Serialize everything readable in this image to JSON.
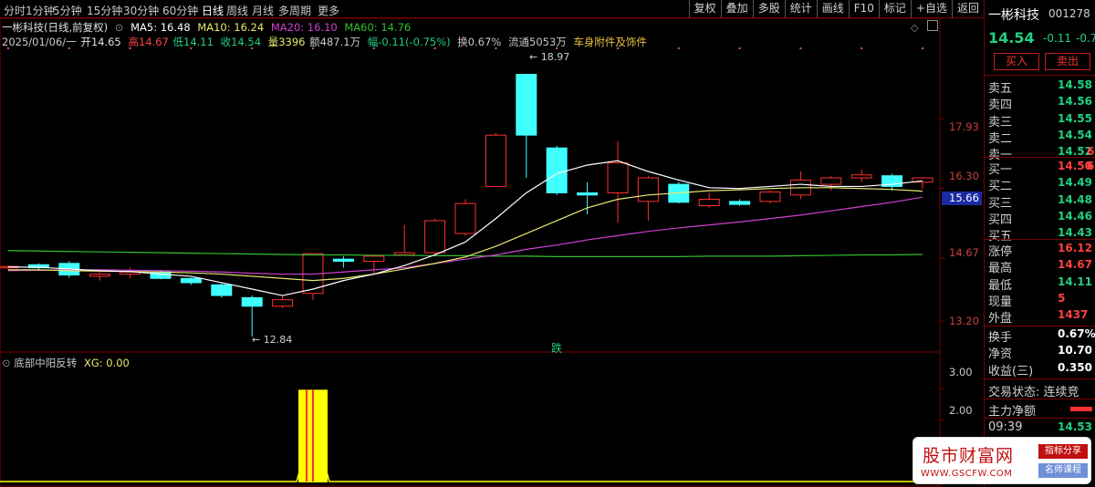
{
  "toolbar": {
    "periods": [
      "分时",
      "1分钟",
      "5分钟",
      "15分钟",
      "30分钟",
      "60分钟",
      "日线",
      "周线",
      "月线",
      "多周期",
      "更多"
    ],
    "active_period": "日线",
    "tools": [
      "复权",
      "叠加",
      "多股",
      "统计",
      "画线",
      "F10",
      "标记",
      "+自选",
      "返回"
    ]
  },
  "header": {
    "title": "一彬科技(日线,前复权)",
    "ma5": "MA5: 16.48",
    "ma10": "MA10: 16.24",
    "ma20": "MA20: 16.10",
    "ma60": "MA60: 14.76",
    "date": "2025/01/06/一",
    "open": "开14.65",
    "high": "高14.67",
    "low": "低14.11",
    "close": "收14.54",
    "volume": "量3396",
    "amount": "额487.1万",
    "change": "幅-0.11(-0.75%)",
    "turnover": "换0.67%",
    "float": "流通5053万",
    "sector": "车身附件及饰件"
  },
  "price_axis": {
    "ticks": [
      "17.93",
      "16.30",
      "14.67",
      "13.20"
    ],
    "current": "15.66"
  },
  "annotations": {
    "high_mark": "18.97",
    "low_mark": "12.84",
    "signal": "跌"
  },
  "indicator": {
    "title": "底部中阳反转",
    "xg": "XG: 0.00",
    "ticks": [
      "3.00",
      "2.00"
    ]
  },
  "colors": {
    "up": "#ff3030",
    "down": "#40ffff",
    "ma5": "#ffffff",
    "ma10": "#e8e870",
    "ma20": "#d040d0",
    "ma60": "#30c030",
    "signal_bar": "#ffff00"
  },
  "chart_data": {
    "type": "candlestick",
    "ylim": [
      12.5,
      19.6
    ],
    "candles": [
      {
        "o": 14.45,
        "c": 14.48,
        "h": 14.5,
        "l": 14.4
      },
      {
        "o": 14.52,
        "c": 14.45,
        "h": 14.55,
        "l": 14.4
      },
      {
        "o": 14.55,
        "c": 14.28,
        "h": 14.6,
        "l": 14.22
      },
      {
        "o": 14.25,
        "c": 14.3,
        "h": 14.35,
        "l": 14.15
      },
      {
        "o": 14.3,
        "c": 14.35,
        "h": 14.45,
        "l": 14.2
      },
      {
        "o": 14.35,
        "c": 14.2,
        "h": 14.4,
        "l": 14.18
      },
      {
        "o": 14.2,
        "c": 14.1,
        "h": 14.22,
        "l": 14.05
      },
      {
        "o": 14.05,
        "c": 13.8,
        "h": 14.08,
        "l": 13.75
      },
      {
        "o": 13.75,
        "c": 13.55,
        "h": 13.8,
        "l": 12.84
      },
      {
        "o": 13.55,
        "c": 13.7,
        "h": 13.8,
        "l": 13.5
      },
      {
        "o": 13.85,
        "c": 14.78,
        "h": 14.78,
        "l": 13.7
      },
      {
        "o": 14.65,
        "c": 14.6,
        "h": 14.72,
        "l": 14.45
      },
      {
        "o": 14.6,
        "c": 14.72,
        "h": 14.75,
        "l": 14.3
      },
      {
        "o": 14.75,
        "c": 14.8,
        "h": 15.45,
        "l": 14.75
      },
      {
        "o": 14.8,
        "c": 15.55,
        "h": 15.6,
        "l": 14.75
      },
      {
        "o": 15.25,
        "c": 15.95,
        "h": 16.05,
        "l": 15.2
      },
      {
        "o": 16.35,
        "c": 17.55,
        "h": 17.6,
        "l": 16.35
      },
      {
        "o": 18.97,
        "c": 17.55,
        "h": 18.97,
        "l": 16.55
      },
      {
        "o": 17.25,
        "c": 16.2,
        "h": 17.3,
        "l": 16.15
      },
      {
        "o": 16.2,
        "c": 16.15,
        "h": 16.45,
        "l": 15.7
      },
      {
        "o": 16.2,
        "c": 16.9,
        "h": 17.4,
        "l": 15.5
      },
      {
        "o": 16.0,
        "c": 16.55,
        "h": 16.6,
        "l": 15.55
      },
      {
        "o": 16.4,
        "c": 15.98,
        "h": 16.45,
        "l": 15.95
      },
      {
        "o": 15.9,
        "c": 16.05,
        "h": 16.2,
        "l": 15.85
      },
      {
        "o": 16.0,
        "c": 15.93,
        "h": 16.05,
        "l": 15.9
      },
      {
        "o": 16.0,
        "c": 16.22,
        "h": 16.25,
        "l": 15.95
      },
      {
        "o": 16.15,
        "c": 16.5,
        "h": 16.7,
        "l": 16.05
      },
      {
        "o": 16.4,
        "c": 16.55,
        "h": 16.6,
        "l": 16.25
      },
      {
        "o": 16.55,
        "c": 16.62,
        "h": 16.75,
        "l": 16.45
      },
      {
        "o": 16.6,
        "c": 16.35,
        "h": 16.65,
        "l": 16.25
      },
      {
        "o": 16.45,
        "c": 16.55,
        "h": 16.57,
        "l": 16.3
      }
    ],
    "ma5": [
      14.47,
      14.46,
      14.42,
      14.38,
      14.36,
      14.3,
      14.25,
      14.1,
      13.95,
      13.8,
      13.95,
      14.15,
      14.3,
      14.5,
      14.75,
      15.05,
      15.6,
      16.2,
      16.65,
      16.85,
      16.95,
      16.7,
      16.5,
      16.32,
      16.3,
      16.35,
      16.4,
      16.35,
      16.35,
      16.4,
      16.48
    ],
    "ma10": [
      14.4,
      14.4,
      14.38,
      14.37,
      14.36,
      14.35,
      14.33,
      14.3,
      14.25,
      14.2,
      14.15,
      14.2,
      14.3,
      14.42,
      14.55,
      14.7,
      14.95,
      15.25,
      15.55,
      15.85,
      16.05,
      16.15,
      16.2,
      16.25,
      16.27,
      16.3,
      16.32,
      16.32,
      16.3,
      16.28,
      16.24
    ],
    "ma20": [
      14.38,
      14.39,
      14.4,
      14.4,
      14.39,
      14.38,
      14.37,
      14.35,
      14.32,
      14.3,
      14.3,
      14.35,
      14.4,
      14.45,
      14.55,
      14.65,
      14.75,
      14.88,
      14.98,
      15.1,
      15.2,
      15.3,
      15.38,
      15.45,
      15.52,
      15.6,
      15.68,
      15.78,
      15.88,
      15.98,
      16.1
    ],
    "ma60": [
      14.85,
      14.84,
      14.83,
      14.82,
      14.81,
      14.8,
      14.79,
      14.78,
      14.77,
      14.76,
      14.75,
      14.75,
      14.74,
      14.74,
      14.73,
      14.73,
      14.72,
      14.72,
      14.71,
      14.71,
      14.71,
      14.71,
      14.71,
      14.72,
      14.72,
      14.72,
      14.73,
      14.74,
      14.75,
      14.75,
      14.76
    ],
    "indicator_values": [
      0,
      0,
      0,
      0,
      0,
      0,
      0,
      0,
      0,
      0,
      3,
      0,
      0,
      0,
      0,
      0,
      0,
      0,
      0,
      0,
      0,
      0,
      0,
      0,
      0,
      0,
      0,
      0,
      0,
      0,
      0
    ],
    "indicator_ylim": [
      0,
      3.6
    ]
  },
  "panel": {
    "name": "一彬科技",
    "code": "001278",
    "price": "14.54",
    "change": "-0.11",
    "change_pct": "-0.7",
    "buy_btn": "买入",
    "sell_btn": "卖出",
    "asks": [
      {
        "label": "卖五",
        "price": "14.58",
        "qty": ""
      },
      {
        "label": "卖四",
        "price": "14.56",
        "qty": ""
      },
      {
        "label": "卖三",
        "price": "14.55",
        "qty": ""
      },
      {
        "label": "卖二",
        "price": "14.54",
        "qty": ""
      },
      {
        "label": "卖一",
        "price": "14.52",
        "qty": "6"
      }
    ],
    "bids": [
      {
        "label": "买一",
        "price": "14.50",
        "qty": "6"
      },
      {
        "label": "买二",
        "price": "14.49",
        "qty": ""
      },
      {
        "label": "买三",
        "price": "14.48",
        "qty": ""
      },
      {
        "label": "买四",
        "price": "14.46",
        "qty": ""
      },
      {
        "label": "买五",
        "price": "14.43",
        "qty": ""
      }
    ],
    "stats": [
      {
        "label": "涨停",
        "value": "16.12"
      },
      {
        "label": "最高",
        "value": "14.67"
      },
      {
        "label": "最低",
        "value": "14.11"
      },
      {
        "label": "现量",
        "value": "5"
      },
      {
        "label": "外盘",
        "value": "1437"
      }
    ],
    "stats2": [
      {
        "label": "换手",
        "value": "0.67%"
      },
      {
        "label": "净资",
        "value": "10.70"
      },
      {
        "label": "收益(三)",
        "value": "0.350"
      }
    ],
    "trade_status": "交易状态: 连续竞",
    "main_net": "主力净额",
    "tick_time": "09:39",
    "tick_price": "14.53"
  },
  "watermark": {
    "title": "股市财富网",
    "url": "WWW.GSCFW.COM",
    "badge1": "指标分享",
    "badge2": "名师课程"
  }
}
